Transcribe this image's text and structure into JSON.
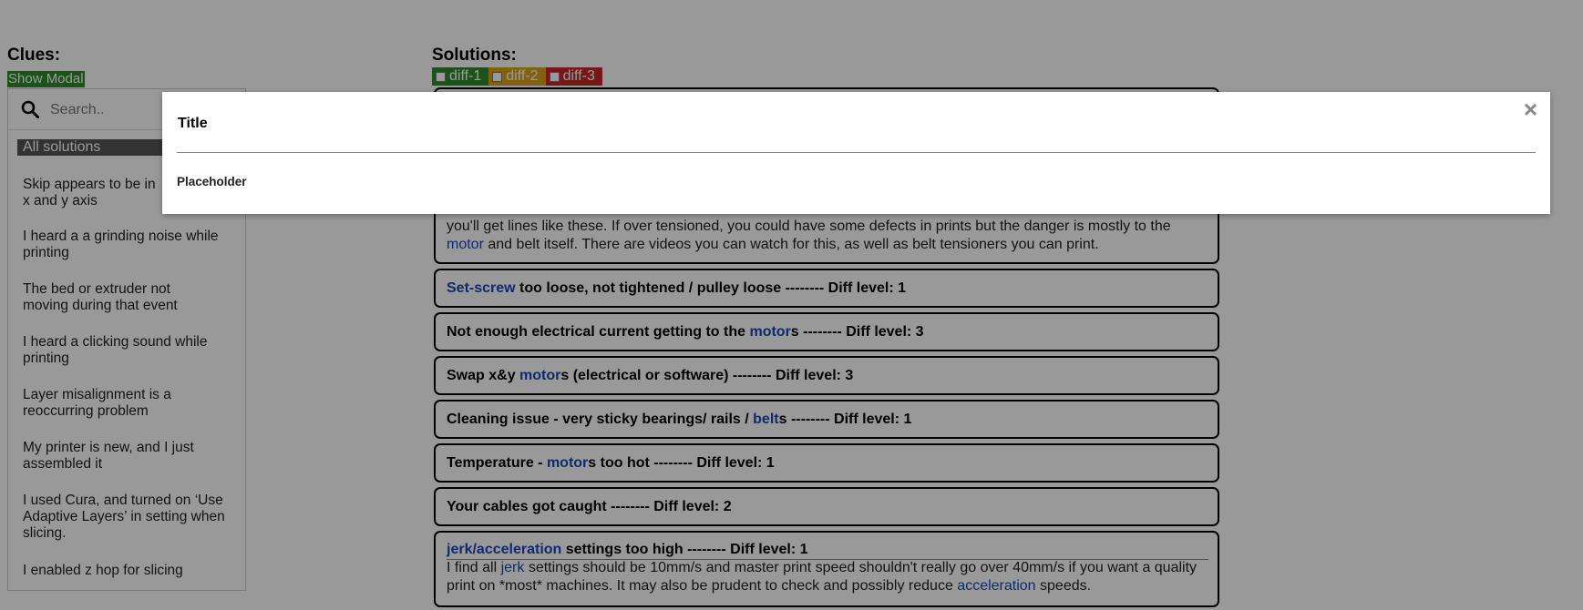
{
  "clues": {
    "heading": "Clues:",
    "show_modal_label": "Show Modal",
    "search_placeholder": "Search..",
    "all_solutions_label": "All solutions",
    "items": [
      "Skip appears to be in x and y axis",
      "I heard a a grinding noise while printing",
      "The bed or extruder not moving during that event",
      "I heard a clicking sound while printing",
      "Layer misalignment is a reoccurring problem",
      "My printer is new, and I just assembled it",
      "I used Cura, and turned on ‘Use Adaptive Layers’ in setting when slicing.",
      "I enabled z hop for slicing"
    ]
  },
  "solutions": {
    "heading": "Solutions:",
    "diff_tabs": [
      {
        "label": "diff-1",
        "color": "#2e8b2e"
      },
      {
        "label": "diff-2",
        "color": "#d9a21a"
      },
      {
        "label": "diff-3",
        "color": "#c62828"
      }
    ],
    "partial_text_line1": "you'll get lines like these. If over tensioned, you could have some defects in prints but the danger is mostly to the",
    "partial_text_link": "motor",
    "partial_text_line2_rest": " and belt itself. There are videos you can watch for this, as well as belt tensioners you can print.",
    "cards": [
      {
        "link": "Set-screw",
        "rest": " too loose, not tightened / pulley loose -------- Diff level: 1"
      },
      {
        "pre": "Not enough electrical current getting to the ",
        "link": "motor",
        "rest": "s -------- Diff level: 3"
      },
      {
        "pre": "Swap x&y ",
        "link": "motor",
        "rest": "s (electrical or software) -------- Diff level: 3"
      },
      {
        "pre": "Cleaning issue - very sticky bearings/ rails / ",
        "link": "belt",
        "rest": "s -------- Diff level: 1"
      },
      {
        "pre": "Temperature - ",
        "link": "motor",
        "rest": "s too hot -------- Diff level: 1"
      },
      {
        "pre": "Your cables got caught -------- Diff level: 2"
      }
    ],
    "jerk_card": {
      "link1": "jerk",
      "sep": "/",
      "link2": "acceleration",
      "title_rest": " settings too high -------- Diff level: 1",
      "text_a": "I find all ",
      "text_link1": "jerk",
      "text_b": " settings should be 10mm/s and master print speed shouldn't really go over 40mm/s if you want a quality print on *most* machines. It may also be prudent to check and possibly reduce ",
      "text_link2": "acceleration",
      "text_c": " speeds."
    }
  },
  "modal": {
    "title": "Title",
    "body": "Placeholder",
    "close_glyph": "×"
  }
}
